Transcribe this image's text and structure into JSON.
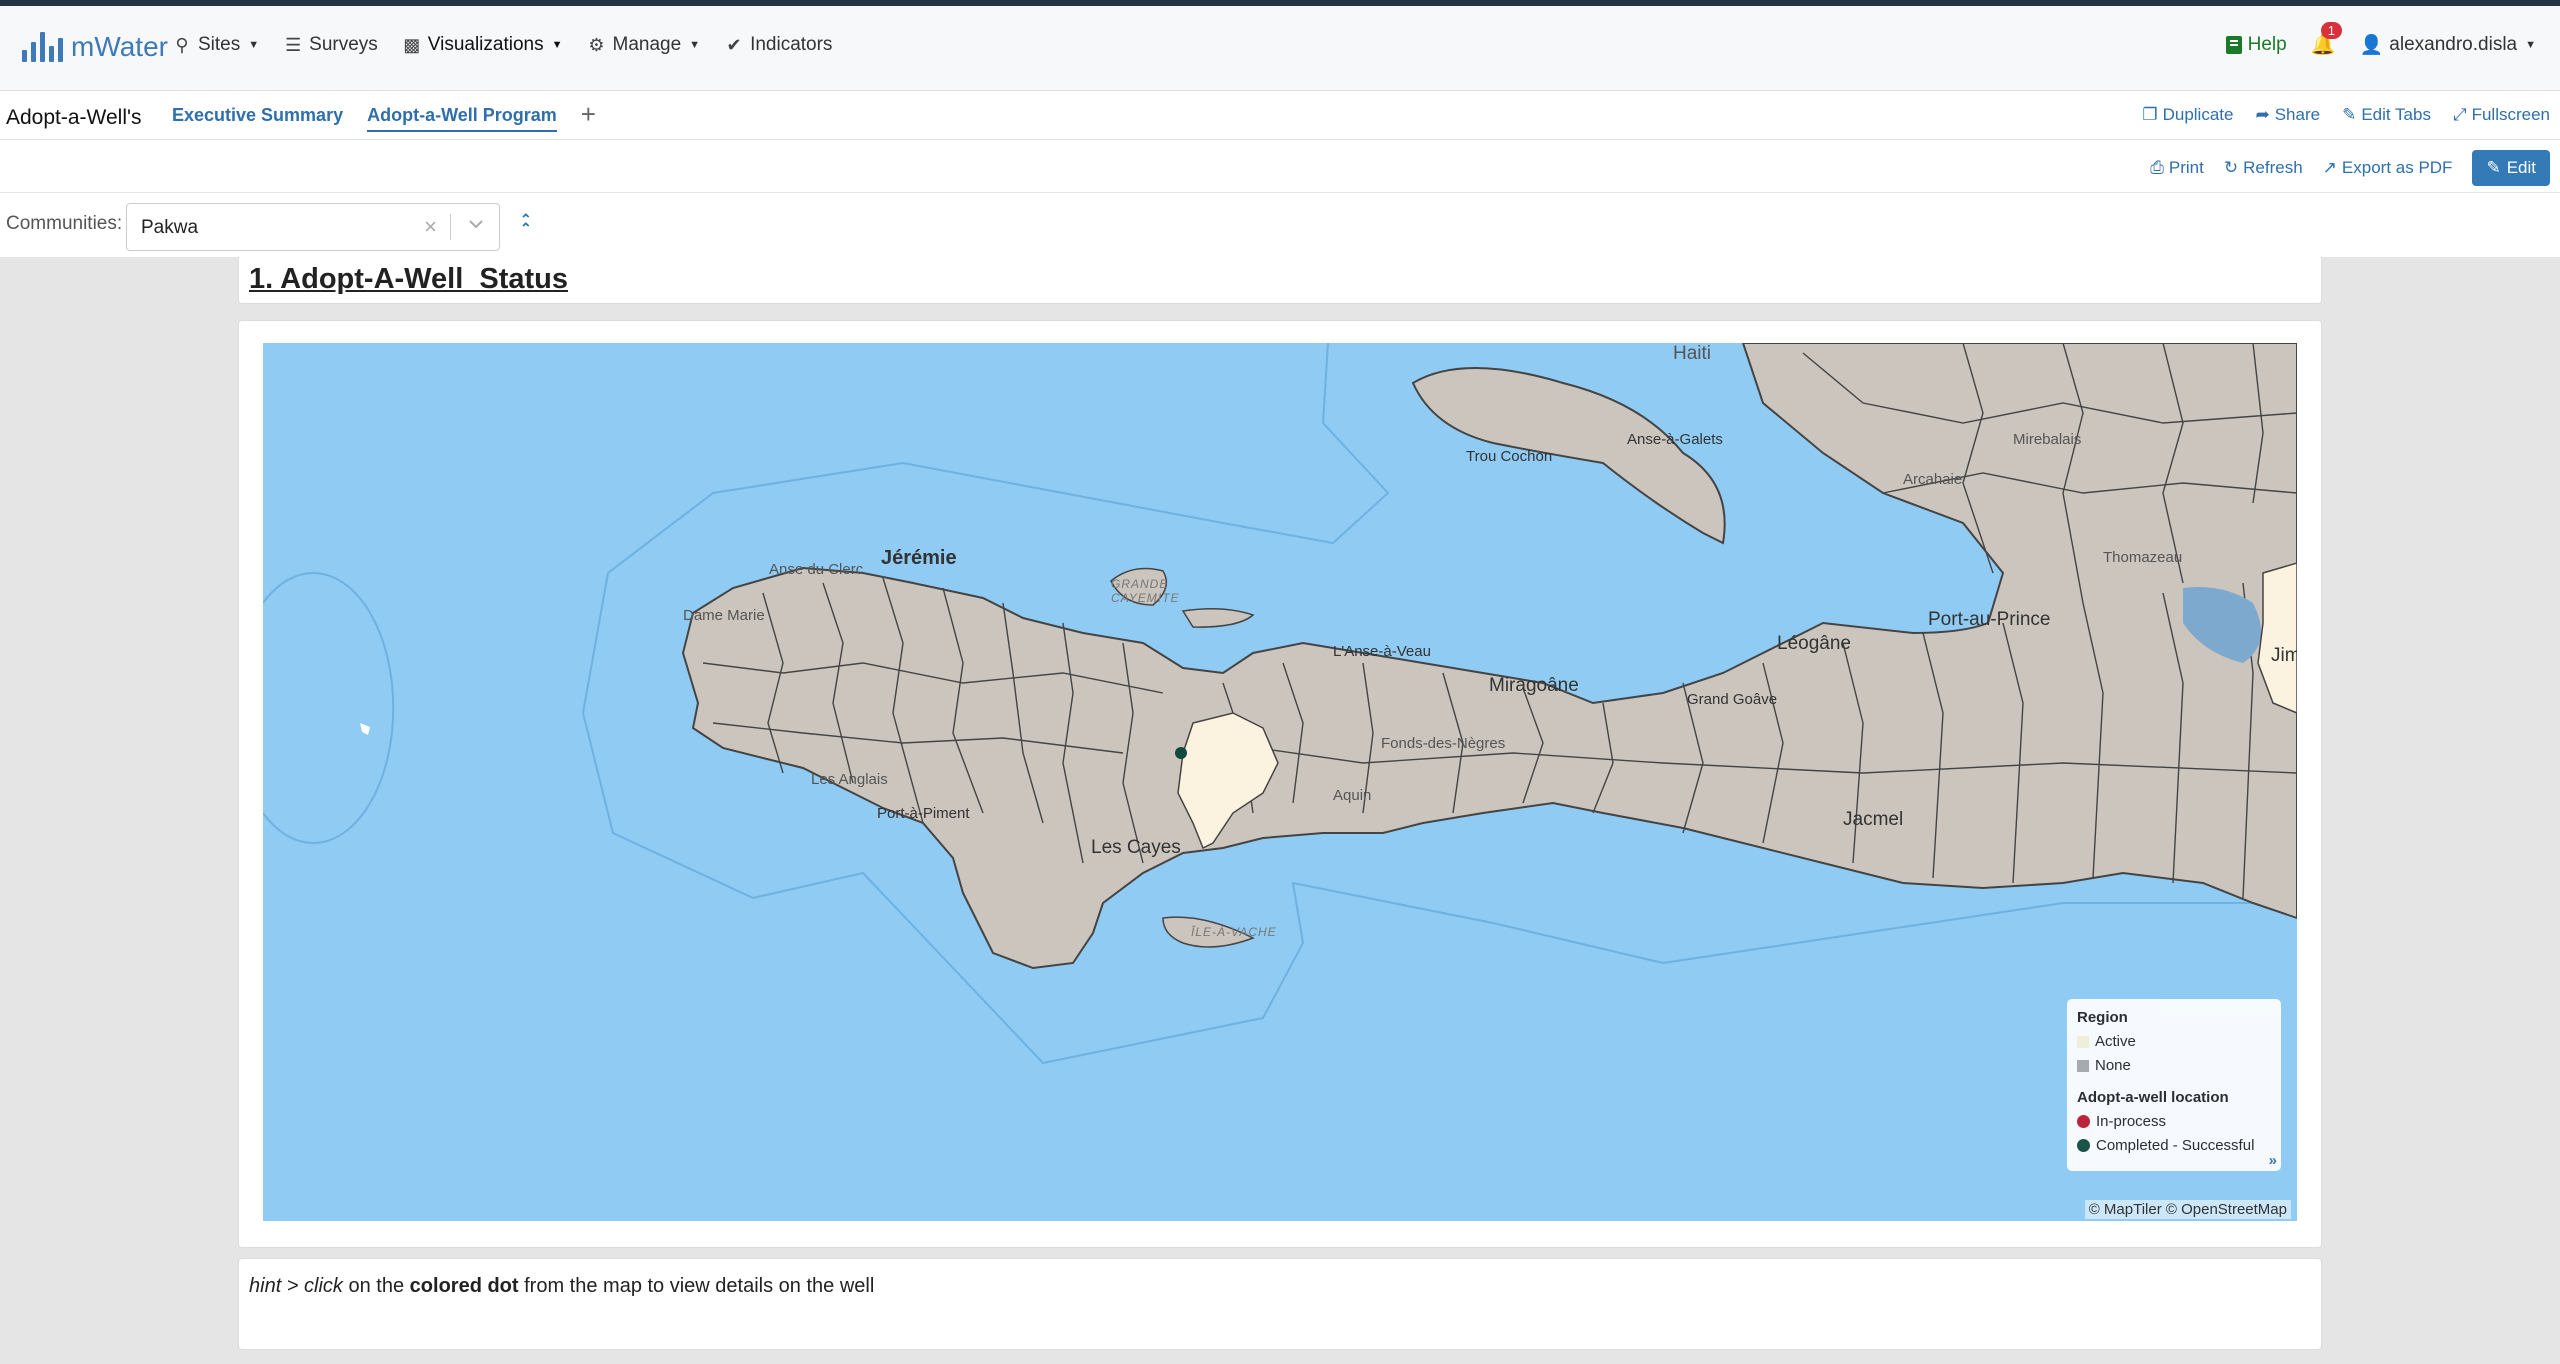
{
  "brand": {
    "name": "mWater"
  },
  "nav": {
    "items": [
      {
        "label": "Sites",
        "icon": "map-marker-icon",
        "dropdown": true
      },
      {
        "label": "Surveys",
        "icon": "list-icon",
        "dropdown": false
      },
      {
        "label": "Visualizations",
        "icon": "bar-chart-icon",
        "dropdown": true
      },
      {
        "label": "Manage",
        "icon": "gear-icon",
        "dropdown": true
      },
      {
        "label": "Indicators",
        "icon": "check-circle-icon",
        "dropdown": false
      }
    ],
    "help_label": "Help",
    "notification_count": "1",
    "username": "alexandro.disla"
  },
  "dashboard": {
    "title": "Adopt-a-Well's",
    "tabs": [
      {
        "label": "Executive Summary",
        "active": false
      },
      {
        "label": "Adopt-a-Well Program",
        "active": true
      }
    ],
    "add_tab": "+",
    "actions": {
      "duplicate": "Duplicate",
      "share": "Share",
      "edit_tabs": "Edit Tabs",
      "fullscreen": "Fullscreen"
    }
  },
  "toolbar": {
    "print": "Print",
    "refresh": "Refresh",
    "export_pdf": "Export as PDF",
    "edit": "Edit"
  },
  "filter": {
    "label": "Communities:",
    "value": "Pakwa"
  },
  "section": {
    "title": "1. Adopt-A-Well_Status"
  },
  "map": {
    "labels": {
      "haiti": "Haiti",
      "anse_a_galets": "Anse-à-Galets",
      "trou_cochon": "Trou Cochon",
      "mirebalais": "Mirebalais",
      "arcahaie": "Arcahaie",
      "thomazeau": "Thomazeau",
      "port_au_prince": "Port-au-Prince",
      "jimani": "Jim",
      "jeremie": "Jérémie",
      "anse_du_clerc": "Anse du Clerc",
      "grande_cayemite": "GRANDE CAYEMITE",
      "dame_marie": "Dame Marie",
      "anse_a_veau": "L'Anse-à-Veau",
      "leogane": "Léogâne",
      "miragoane": "Miragoâne",
      "grand_goave": "Grand Goâve",
      "fonds_des_negres": "Fonds-des-Nègres",
      "les_anglais": "Les Anglais",
      "aquin": "Aquin",
      "port_a_piment": "Port-à-Piment",
      "les_cayes": "Les Cayes",
      "jacmel": "Jacmel",
      "ile_a_vache": "ÎLE-À-VACHE"
    },
    "legend": {
      "region_title": "Region",
      "region_items": [
        {
          "label": "Active",
          "color": "#f8f1d6"
        },
        {
          "label": "None",
          "color": "#a9a9a9"
        }
      ],
      "location_title": "Adopt-a-well location",
      "location_items": [
        {
          "label": "In-process",
          "color": "#c0182a"
        },
        {
          "label": "Completed - Successful",
          "color": "#0f4a3c"
        }
      ],
      "expand": "»"
    },
    "attribution": "© MapTiler © OpenStreetMap",
    "colors": {
      "sea": "#8fcbf3",
      "land": "#cbc5bd",
      "active_region": "#fbf3df",
      "border": "#333333"
    }
  },
  "hint": {
    "prefix": "hint > click",
    "on_the": "on the",
    "bold": "colored dot",
    "suffix": "from the map to view details on the well"
  }
}
